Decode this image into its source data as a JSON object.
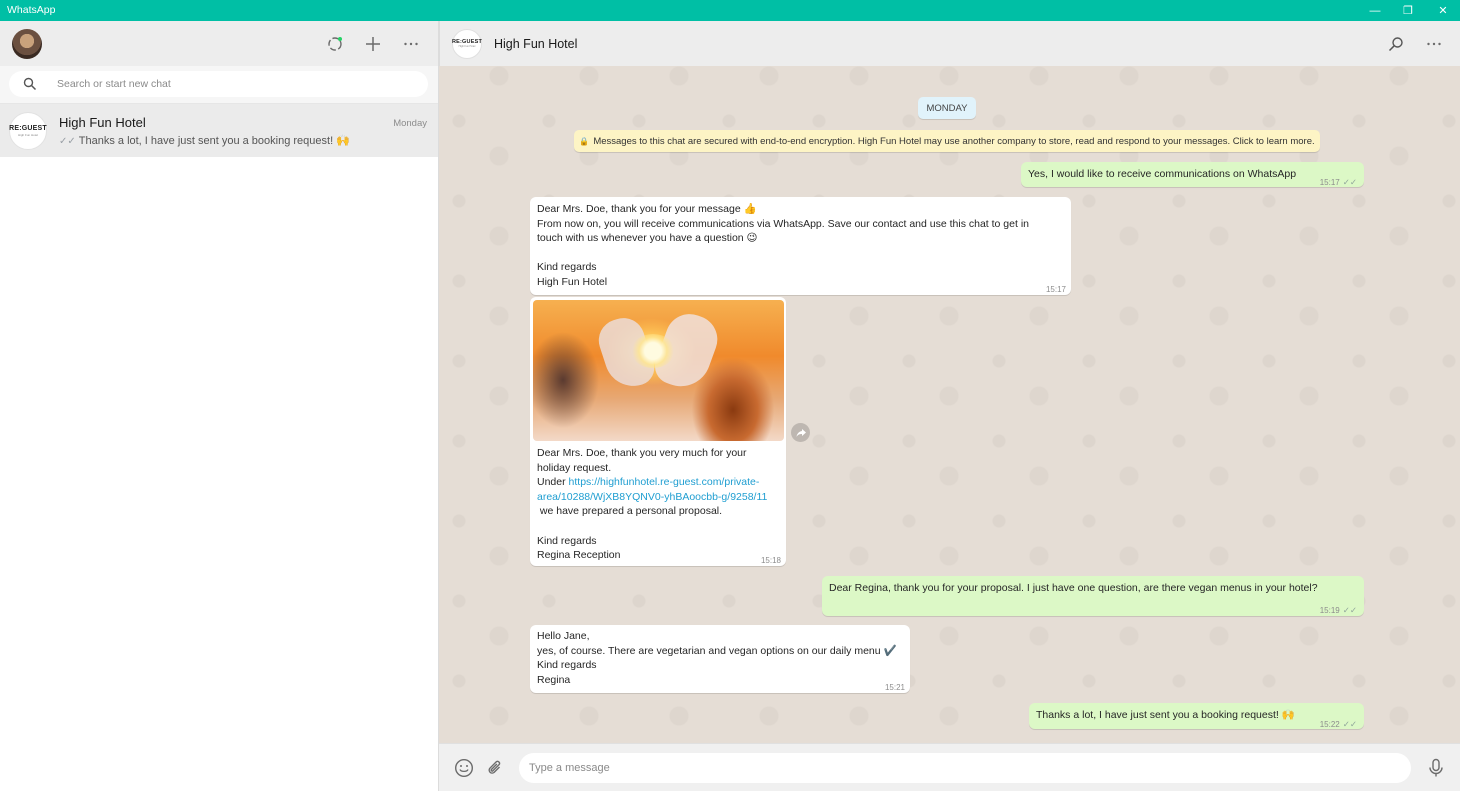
{
  "window": {
    "title": "WhatsApp",
    "minimize": "—",
    "restore": "❐",
    "close": "✕"
  },
  "sidebar": {
    "icons": {
      "status": "status-icon",
      "new_chat": "plus-icon",
      "menu": "more-icon"
    },
    "search": {
      "placeholder": "Search or start new chat"
    },
    "chats": [
      {
        "name": "High Fun Hotel",
        "time": "Monday",
        "preview": "Thanks a lot, I have just sent you a booking request! 🙌",
        "avatar_text": "RE:GUEST",
        "avatar_sub": "High Fun Hotel"
      }
    ]
  },
  "conversation": {
    "contact_name": "High Fun Hotel",
    "avatar_text": "RE:GUEST",
    "avatar_sub": "High Fun Hotel",
    "date_label": "MONDAY",
    "encryption_notice": "Messages to this chat are secured with end-to-end encryption. High Fun Hotel may use another company to store, read and respond to your messages. Click to learn more.",
    "messages": [
      {
        "dir": "out",
        "text": "Yes, I would like to receive communications on WhatsApp",
        "time": "15:17",
        "status": "read"
      },
      {
        "dir": "in",
        "text": "Dear Mrs. Doe, thank you for your message 👍\nFrom now on, you will receive communications via WhatsApp. Save our contact and use this chat to get in\ntouch with us whenever you have a question 😉\n\nKind regards\nHigh Fun Hotel",
        "time": "15:17"
      },
      {
        "dir": "in",
        "type": "image",
        "caption_1": "Dear Mrs. Doe, thank you very much for your\nholiday request.\nUnder ",
        "link": "https://highfunhotel.re-guest.com/private-\narea/10288/WjXB8YQNV0-yhBAoocbb-g/9258/11",
        "caption_2": "\n we have prepared a personal proposal.\n\nKind regards\nRegina Reception",
        "time": "15:18"
      },
      {
        "dir": "out",
        "text": "Dear Regina, thank you for your proposal. I just have one question, are there vegan menus in your hotel?",
        "time": "15:19",
        "status": "read"
      },
      {
        "dir": "in",
        "text": "Hello Jane,\nyes, of course. There are vegetarian and vegan options on our daily menu ✔️\nKind regards\nRegina",
        "time": "15:21"
      },
      {
        "dir": "out",
        "text": "Thanks a lot, I have just sent you a booking request! 🙌",
        "time": "15:22",
        "status": "read"
      }
    ]
  },
  "composer": {
    "placeholder": "Type a message",
    "icons": [
      "emoji-icon",
      "attach-icon",
      "mic-icon"
    ]
  },
  "colors": {
    "accent": "#00bfa5",
    "outgoing_bubble": "#dcf8c6",
    "incoming_bubble": "#ffffff",
    "chat_bg": "#e5ddd5",
    "link": "#1f9ed1"
  }
}
